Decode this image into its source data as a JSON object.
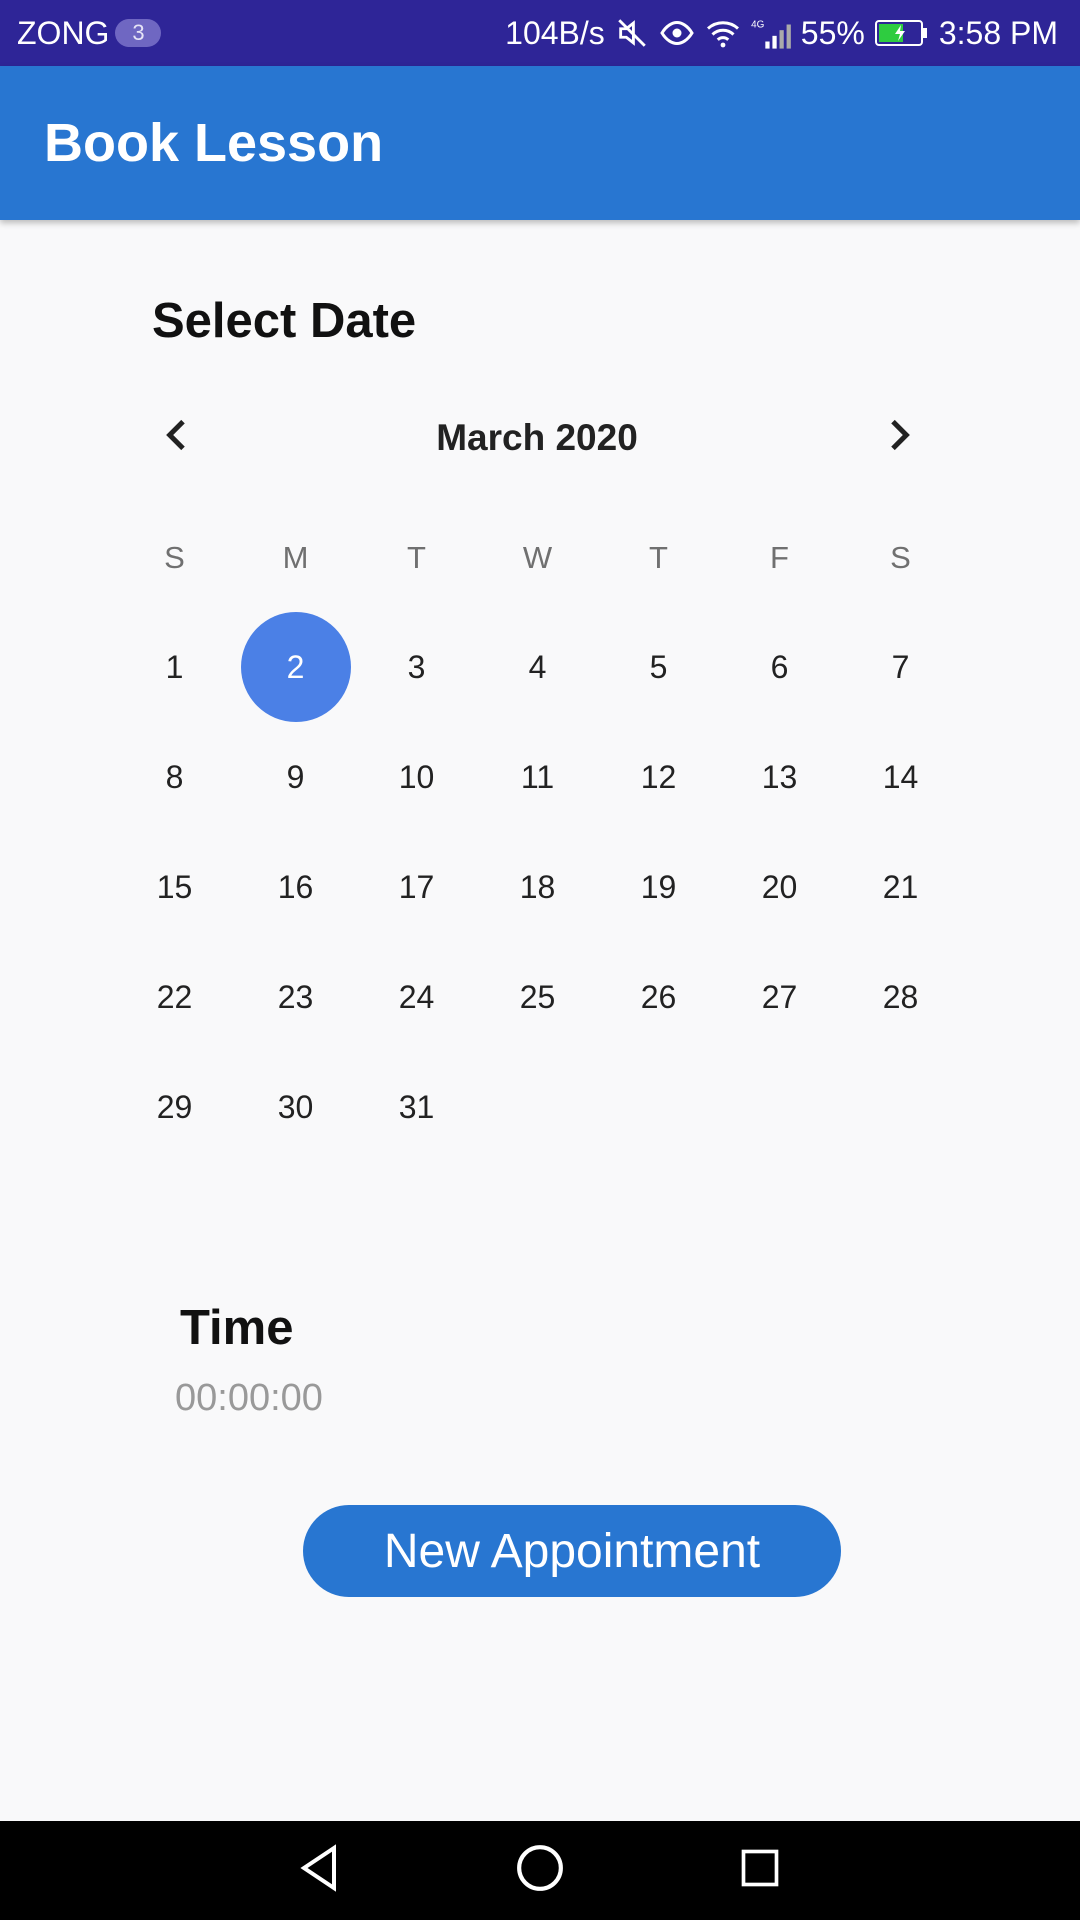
{
  "status_bar": {
    "carrier": "ZONG",
    "sim_badge": "3",
    "net_speed": "104B/s",
    "battery": "55%",
    "time": "3:58 PM",
    "icons": [
      "mute-icon",
      "eye-comfort-icon",
      "wifi-icon",
      "4g-signal-icon",
      "battery-charging-icon"
    ]
  },
  "app_bar": {
    "title": "Book Lesson"
  },
  "date_section": {
    "label": "Select Date"
  },
  "calendar": {
    "month_title": "March 2020",
    "prev_icon": "chevron-left-icon",
    "next_icon": "chevron-right-icon",
    "weekdays": [
      "S",
      "M",
      "T",
      "W",
      "T",
      "F",
      "S"
    ],
    "weeks": [
      [
        "1",
        "2",
        "3",
        "4",
        "5",
        "6",
        "7"
      ],
      [
        "8",
        "9",
        "10",
        "11",
        "12",
        "13",
        "14"
      ],
      [
        "15",
        "16",
        "17",
        "18",
        "19",
        "20",
        "21"
      ],
      [
        "22",
        "23",
        "24",
        "25",
        "26",
        "27",
        "28"
      ],
      [
        "29",
        "30",
        "31",
        "",
        "",
        "",
        ""
      ]
    ],
    "selected_day": "2",
    "selected_color": "#4b80e6"
  },
  "time_section": {
    "label": "Time",
    "value": "00:00:00"
  },
  "actions": {
    "new_appointment_label": "New Appointment"
  },
  "colors": {
    "status_bar": "#2e2597",
    "app_bar": "#2876d1",
    "button": "#2876d1",
    "background": "#f9f9fa"
  },
  "nav_bar": {
    "icons": [
      "back-icon",
      "home-icon",
      "recents-icon"
    ]
  }
}
